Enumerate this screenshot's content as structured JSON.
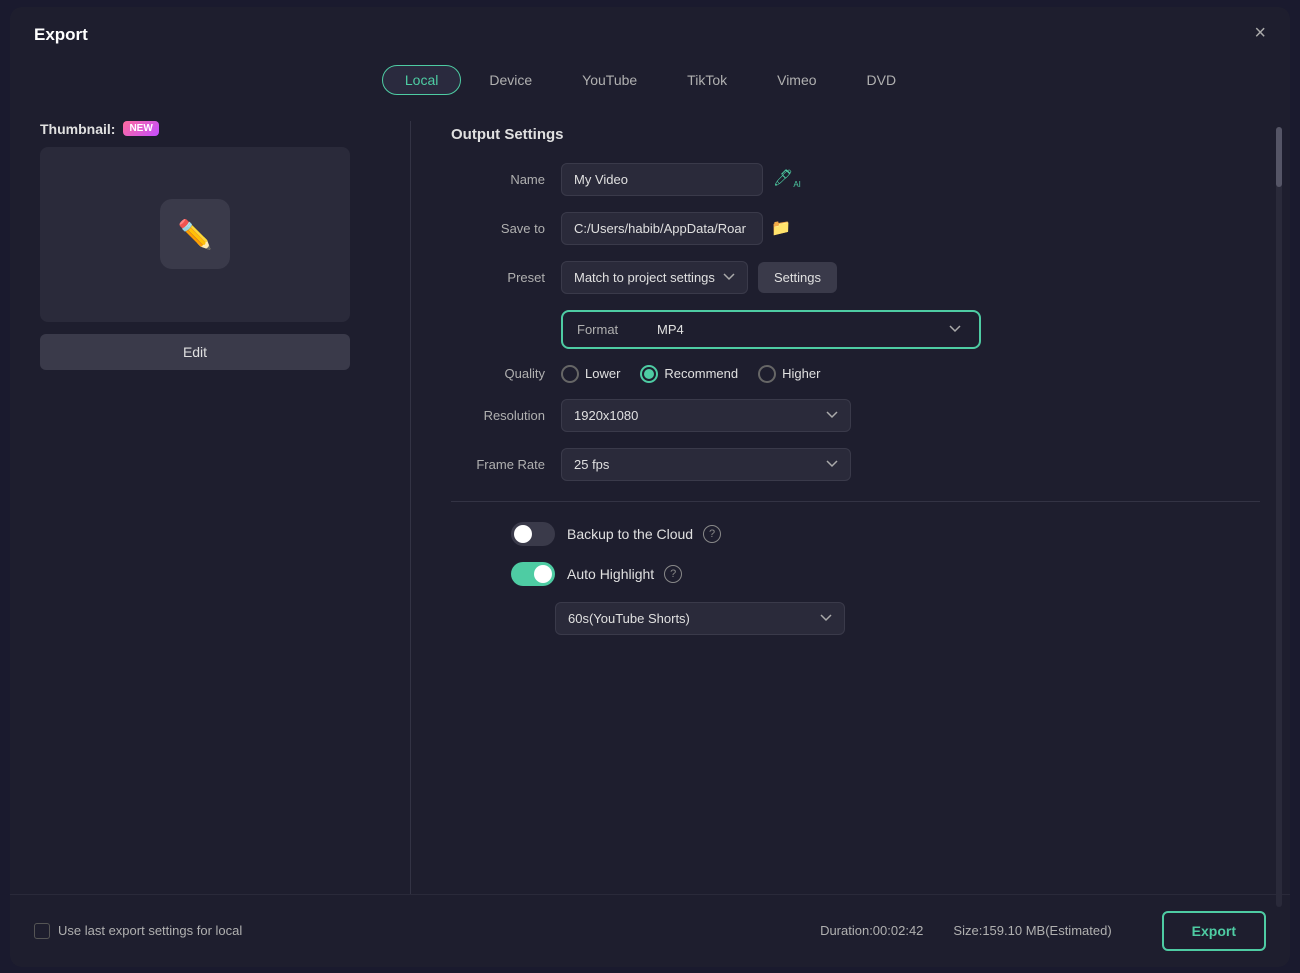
{
  "dialog": {
    "title": "Export",
    "close_label": "×"
  },
  "tabs": [
    {
      "id": "local",
      "label": "Local",
      "active": true
    },
    {
      "id": "device",
      "label": "Device",
      "active": false
    },
    {
      "id": "youtube",
      "label": "YouTube",
      "active": false
    },
    {
      "id": "tiktok",
      "label": "TikTok",
      "active": false
    },
    {
      "id": "vimeo",
      "label": "Vimeo",
      "active": false
    },
    {
      "id": "dvd",
      "label": "DVD",
      "active": false
    }
  ],
  "left_panel": {
    "thumbnail_label": "Thumbnail:",
    "new_badge": "NEW",
    "edit_button_label": "Edit"
  },
  "output_settings": {
    "section_title": "Output Settings",
    "name_label": "Name",
    "name_value": "My Video",
    "save_to_label": "Save to",
    "save_to_value": "C:/Users/habib/AppData/Roar",
    "preset_label": "Preset",
    "preset_value": "Match to project settings",
    "settings_button_label": "Settings",
    "format_label": "Format",
    "format_value": "MP4",
    "quality_label": "Quality",
    "quality_options": [
      {
        "id": "lower",
        "label": "Lower",
        "checked": false
      },
      {
        "id": "recommend",
        "label": "Recommend",
        "checked": true
      },
      {
        "id": "higher",
        "label": "Higher",
        "checked": false
      }
    ],
    "resolution_label": "Resolution",
    "resolution_value": "1920x1080",
    "frame_rate_label": "Frame Rate",
    "frame_rate_value": "25 fps",
    "backup_cloud_label": "Backup to the Cloud",
    "backup_cloud_on": false,
    "auto_highlight_label": "Auto Highlight",
    "auto_highlight_on": true,
    "youtube_shorts_value": "60s(YouTube Shorts)"
  },
  "bottom_bar": {
    "use_last_label": "Use last export settings for local",
    "duration_label": "Duration:00:02:42",
    "size_label": "Size:159.10 MB(Estimated)",
    "export_button_label": "Export"
  }
}
